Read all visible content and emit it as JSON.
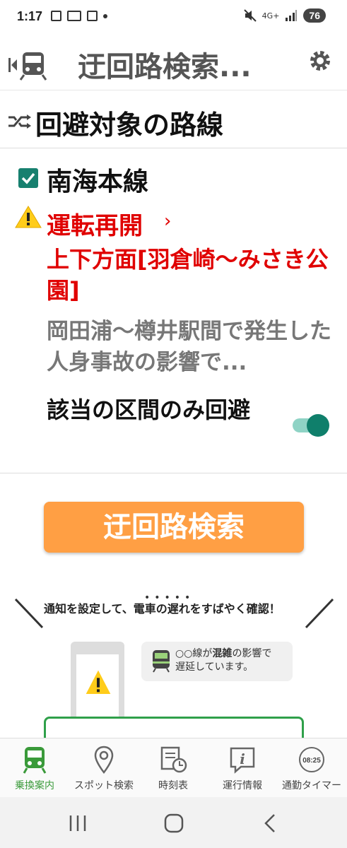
{
  "status_bar": {
    "time": "1:17",
    "network": "4G+",
    "battery": "76"
  },
  "header": {
    "title": "迂回路検索..."
  },
  "section": {
    "title": "回避対象の路線"
  },
  "line": {
    "name": "南海本線",
    "status": "運転再開",
    "direction": "上下方面[羽倉崎〜みさき公園]",
    "detail": "岡田浦〜樽井駅間で発生した人身事故の影響で...",
    "toggle_label": "該当の区間のみ回避"
  },
  "search_button": "迂回路検索",
  "promo": {
    "headline_pre": "通知を設定して、",
    "headline_em": "電車の遅れ",
    "headline_post": "をすばやく確認！",
    "bubble_pre": "○○線が",
    "bubble_em": "混雑",
    "bubble_post": "の影響で",
    "bubble_line2": "遅延しています。"
  },
  "tabs": [
    {
      "label": "乗換案内"
    },
    {
      "label": "スポット検索"
    },
    {
      "label": "時刻表"
    },
    {
      "label": "運行情報"
    },
    {
      "label": "通勤タイマー"
    }
  ],
  "timer_icon_text": "08:25",
  "colors": {
    "accent_green": "#17806f",
    "alert_red": "#e00000",
    "button_orange": "#ff9f44",
    "tab_active": "#3a9a3a"
  }
}
